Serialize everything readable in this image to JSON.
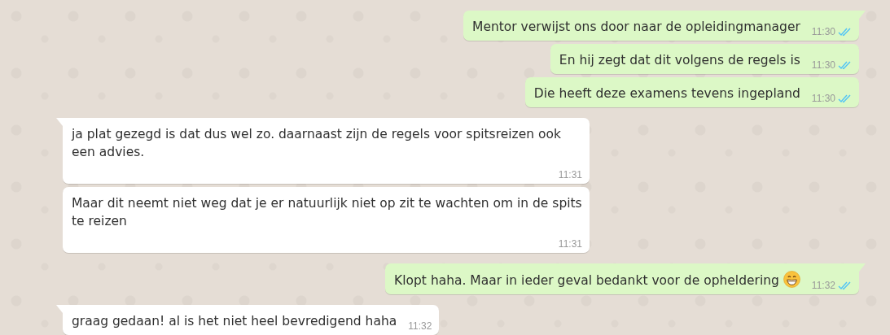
{
  "chat": {
    "messages": [
      {
        "kind": "outgoing",
        "tail": true,
        "text": "Mentor verwijst ons door naar de opleidingmanager",
        "time": "11:30",
        "read": true
      },
      {
        "kind": "outgoing",
        "tail": false,
        "text": "En hij zegt dat dit volgens de regels is",
        "time": "11:30",
        "read": true
      },
      {
        "kind": "outgoing",
        "tail": false,
        "text": "Die heeft deze examens tevens ingepland",
        "time": "11:30",
        "read": true
      },
      {
        "kind": "incoming",
        "tail": true,
        "text": "ja plat gezegd is dat dus wel zo. daarnaast zijn de regels voor spitsreizen ook een advies.",
        "time": "11:31"
      },
      {
        "kind": "incoming",
        "tail": false,
        "text": "Maar dit neemt niet weg dat je er natuurlijk niet op zit te wachten om in de spits te reizen",
        "time": "11:31"
      },
      {
        "kind": "outgoing",
        "tail": true,
        "text": "Klopt haha. Maar in ieder geval bedankt voor de opheldering",
        "emoji": {
          "kind": "grin"
        },
        "time": "11:32",
        "read": true
      },
      {
        "kind": "incoming",
        "tail": true,
        "text": "graag gedaan! al is het niet heel bevredigend haha",
        "time": "11:32"
      }
    ]
  }
}
